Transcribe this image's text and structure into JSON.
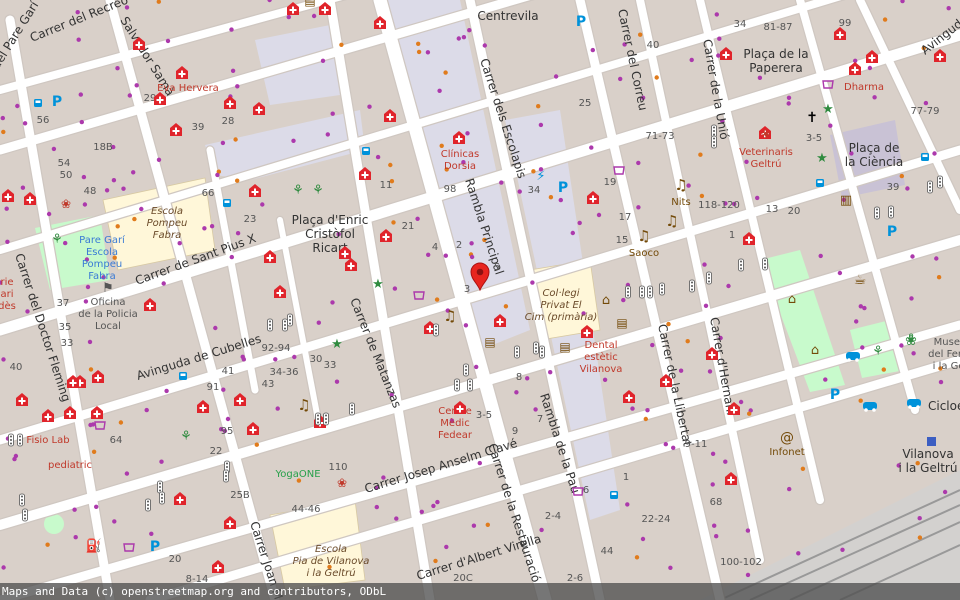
{
  "colors": {
    "background": "#e0dfdf",
    "block": "#d9d0c9",
    "road": "#ffffff",
    "road_casing": "#cfc7c1",
    "pedestrian": "#dcdbe8",
    "school": "#ffffe5",
    "park": "#c8facc",
    "hospital_red": "#e0242b",
    "shop_purple": "#ac39ac",
    "amenity_brown": "#734a08",
    "transport_blue": "#0092da",
    "rail": "#999999",
    "marker": "#e8251f"
  },
  "streets": {
    "carrer_del_recreo": "Carrer del Recreo",
    "del_pare_garí": "del Pare Garí",
    "salvador_sama": "Salvador Samà",
    "carrer_de_sant_pius_x": "Carrer de Sant Pius X",
    "avinguda_de_cubelles": "Avinguda de Cubelles",
    "carrer_del_doctor_fleming": "Carrer del Doctor Fleming",
    "carrer_de_matanzas": "Carrer de Matanzas",
    "carrer_josep_anselm_clave": "Carrer Josep Anselm Clavé",
    "carrer_joan_m": "Carrer Joan M",
    "carrer_d_albert_virella": "Carrer d'Albert Virella",
    "carrer_de_la_restauracio": "Carrer de la Restauració",
    "rambla_de_la_pau": "Rambla de la Pau",
    "rambla_principal": "Rambla Principal",
    "carrer_dels_escolapis": "Carrer dels Escolapis",
    "carrer_del_correu": "Carrer del Correu",
    "carrer_de_la_unio": "Carrer de la Unió",
    "carrer_de_la_llibertat": "Carrer de la Llibertat",
    "carrer_d_hernani": "Carrer d'Hernani",
    "avinguda": "Avinguda",
    "cicloe": "Cicloe"
  },
  "places": {
    "centrevila": "Centrevila",
    "placa_enric_1": "Plaça d'Enric",
    "placa_enric_2": "Cristòfol",
    "placa_enric_3": "Ricart",
    "placa_paperera_1": "Plaça de la",
    "placa_paperera_2": "Paperera",
    "placa_ciencia_1": "Plaça de",
    "placa_ciencia_2": "la Ciència",
    "vilanova_1": "Vilanova",
    "vilanova_2": "i la Geltrú"
  },
  "pois": {
    "eva_hervera": "Eva Hervera",
    "clinicas_1": "Clínicas",
    "clinicas_2": "Dorsia",
    "escola_pompeu_1": "Escola",
    "escola_pompeu_2": "Pompeu",
    "escola_pompeu_3": "Fabra",
    "pare_gari_1": "Pare Garí",
    "pare_gari_2": "Escola",
    "pare_gari_3": "Pompeu",
    "pare_gari_4": "Fabra",
    "oficina_1": "Oficina",
    "oficina_2": "de la Policia",
    "oficina_3": "Local",
    "fisio_lab": "Fisio Lab",
    "pediatric": "pediatric",
    "yogaone": "YogaONE",
    "escola_pia_1": "Escola",
    "escola_pia_2": "Pia de Vilanova",
    "escola_pia_3": "i la Geltrú",
    "centre_medic_1": "Centre",
    "centre_medic_2": "Mèdic",
    "centre_medic_3": "Fedear",
    "collegi_1": "Col·legi",
    "collegi_2": "Privat El",
    "collegi_3": "Cim (primària)",
    "dental_1": "Dental",
    "dental_2": "estètic",
    "dental_3": "Vilanova",
    "nits": "Nits",
    "saoco": "Saoco",
    "veterinaris_1": "Veterinaris",
    "veterinaris_2": "Geltrú",
    "dharma": "Dharma",
    "infonet": "Infonet",
    "museu_1": "Museu",
    "museu_2": "del Ferro",
    "museu_3": "i la Gel"
  },
  "edge_text": {
    "rie": "rie",
    "des": "dès",
    "ari": "ari"
  },
  "house_numbers": {
    "n54a": "54",
    "n56": "56",
    "n50": "50",
    "n48": "48",
    "n18b": "18B",
    "n37a": "37",
    "n35": "35",
    "n33": "33",
    "n40": "40",
    "n66": "66",
    "n23": "23",
    "n29": "29",
    "n28": "28",
    "n39": "39",
    "n41": "41",
    "n43": "43",
    "n91": "91",
    "n95": "95",
    "n64": "64",
    "n22": "22",
    "n25b": "25B",
    "n20": "20",
    "n8_14": "8-14",
    "n92_94": "92-94",
    "n34_36": "34-36",
    "n30": "30",
    "n33b": "33",
    "n110": "110",
    "n44_46": "44-46",
    "n11": "11",
    "n21": "21",
    "n4": "4",
    "n2": "2",
    "n98": "98",
    "n34": "34",
    "n5": "5",
    "n3": "3",
    "n17": "17",
    "n15": "15",
    "n19": "19",
    "n25": "25",
    "n3_5": "3-5",
    "n9": "9",
    "n7": "7",
    "n20c": "20C",
    "n2_6": "2-6",
    "n44": "44",
    "n8": "8",
    "n6": "6",
    "n71_73": "71-73",
    "n40b": "40",
    "n34b": "34",
    "n118_120": "118-120",
    "n20b": "20",
    "n81_87": "81-87",
    "n99": "99",
    "n77_79": "77-79",
    "n3_5b": "3-5",
    "n13": "13",
    "n68": "68",
    "n22_24": "22-24",
    "n100_102": "100-102",
    "n2_4": "2-4",
    "n1": "1",
    "n9_11": "9-11",
    "n39b": "39",
    "n1b": "1"
  },
  "attribution": "Maps and Data (c) openstreetmap.org and contributors, ODbL"
}
